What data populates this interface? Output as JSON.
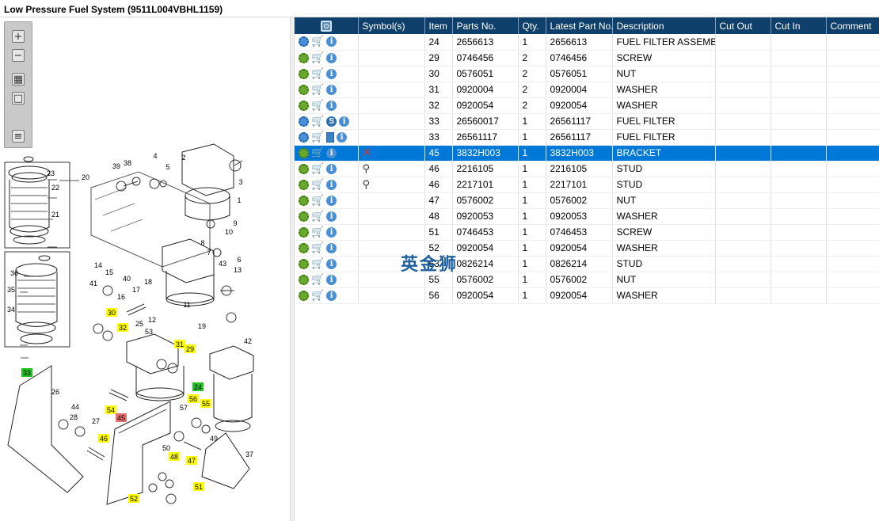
{
  "window": {
    "title": "Low Pressure Fuel System (9511L004VBHL1159)"
  },
  "toolbar": {
    "buttons": [
      {
        "name": "zoom-in-button",
        "glyph": "+"
      },
      {
        "name": "zoom-out-button",
        "glyph": "−"
      },
      {
        "name": "fit-all-button",
        "glyph": "▦"
      },
      {
        "name": "fit-page-button",
        "glyph": "□"
      },
      {
        "name": "show-list-button",
        "glyph": "≡"
      }
    ]
  },
  "diagram": {
    "callouts": [
      {
        "label": "23",
        "color": "none"
      },
      {
        "label": "22",
        "color": "none"
      },
      {
        "label": "21",
        "color": "none"
      },
      {
        "label": "20",
        "color": "none"
      },
      {
        "label": "36",
        "color": "none"
      },
      {
        "label": "35",
        "color": "none"
      },
      {
        "label": "34",
        "color": "none"
      },
      {
        "label": "33",
        "color": "green"
      },
      {
        "label": "39",
        "color": "none"
      },
      {
        "label": "38",
        "color": "none"
      },
      {
        "label": "4",
        "color": "none"
      },
      {
        "label": "5",
        "color": "none"
      },
      {
        "label": "2",
        "color": "none"
      },
      {
        "label": "3",
        "color": "none"
      },
      {
        "label": "1",
        "color": "none"
      },
      {
        "label": "10",
        "color": "none"
      },
      {
        "label": "9",
        "color": "none"
      },
      {
        "label": "8",
        "color": "none"
      },
      {
        "label": "7",
        "color": "none"
      },
      {
        "label": "6",
        "color": "none"
      },
      {
        "label": "14",
        "color": "none"
      },
      {
        "label": "15",
        "color": "none"
      },
      {
        "label": "18",
        "color": "none"
      },
      {
        "label": "43",
        "color": "none"
      },
      {
        "label": "13",
        "color": "none"
      },
      {
        "label": "41",
        "color": "none"
      },
      {
        "label": "40",
        "color": "none"
      },
      {
        "label": "16",
        "color": "none"
      },
      {
        "label": "17",
        "color": "none"
      },
      {
        "label": "12",
        "color": "none"
      },
      {
        "label": "11",
        "color": "none"
      },
      {
        "label": "19",
        "color": "none"
      },
      {
        "label": "30",
        "color": "yellow"
      },
      {
        "label": "32",
        "color": "yellow"
      },
      {
        "label": "25",
        "color": "none"
      },
      {
        "label": "53",
        "color": "none"
      },
      {
        "label": "31",
        "color": "yellow"
      },
      {
        "label": "29",
        "color": "yellow"
      },
      {
        "label": "42",
        "color": "none"
      },
      {
        "label": "24",
        "color": "green"
      },
      {
        "label": "26",
        "color": "none"
      },
      {
        "label": "44",
        "color": "none"
      },
      {
        "label": "28",
        "color": "none"
      },
      {
        "label": "27",
        "color": "none"
      },
      {
        "label": "54",
        "color": "yellow"
      },
      {
        "label": "45",
        "color": "red"
      },
      {
        "label": "57",
        "color": "none"
      },
      {
        "label": "56",
        "color": "yellow"
      },
      {
        "label": "55",
        "color": "yellow"
      },
      {
        "label": "46",
        "color": "yellow"
      },
      {
        "label": "50",
        "color": "none"
      },
      {
        "label": "49",
        "color": "none"
      },
      {
        "label": "48",
        "color": "yellow"
      },
      {
        "label": "47",
        "color": "yellow"
      },
      {
        "label": "37",
        "color": "none"
      },
      {
        "label": "52",
        "color": "yellow"
      },
      {
        "label": "51",
        "color": "yellow"
      }
    ]
  },
  "table": {
    "columns": [
      "Symbol(s)",
      "Item",
      "Parts No.",
      "Qty.",
      "Latest Part No.",
      "Description",
      "Cut Out",
      "Cut In",
      "Comment"
    ],
    "rows": [
      {
        "icons": "gear-blue,cart,info",
        "symbol": "",
        "item": "24",
        "part_no": "2656613",
        "qty": "1",
        "latest": "2656613",
        "desc": "FUEL FILTER ASSEMBLY",
        "cut_out": "",
        "cut_in": "",
        "comment": ""
      },
      {
        "icons": "gear,cart,info",
        "symbol": "",
        "item": "29",
        "part_no": "0746456",
        "qty": "2",
        "latest": "0746456",
        "desc": "SCREW",
        "cut_out": "",
        "cut_in": "",
        "comment": ""
      },
      {
        "icons": "gear,cart,info",
        "symbol": "",
        "item": "30",
        "part_no": "0576051",
        "qty": "2",
        "latest": "0576051",
        "desc": "NUT",
        "cut_out": "",
        "cut_in": "",
        "comment": ""
      },
      {
        "icons": "gear,cart,info",
        "symbol": "",
        "item": "31",
        "part_no": "0920004",
        "qty": "2",
        "latest": "0920004",
        "desc": "WASHER",
        "cut_out": "",
        "cut_in": "",
        "comment": ""
      },
      {
        "icons": "gear,cart,info",
        "symbol": "",
        "item": "32",
        "part_no": "0920054",
        "qty": "2",
        "latest": "0920054",
        "desc": "WASHER",
        "cut_out": "",
        "cut_in": "",
        "comment": ""
      },
      {
        "icons": "gear-blue,cart,s,info",
        "symbol": "",
        "item": "33",
        "part_no": "26560017",
        "qty": "1",
        "latest": "26561117",
        "desc": "FUEL FILTER",
        "cut_out": "",
        "cut_in": "",
        "comment": ""
      },
      {
        "icons": "gear-blue,cart,doc,info",
        "symbol": "",
        "item": "33",
        "part_no": "26561117",
        "qty": "1",
        "latest": "26561117",
        "desc": "FUEL FILTER",
        "cut_out": "",
        "cut_in": "",
        "comment": ""
      },
      {
        "icons": "gear,cart,info",
        "symbol": "x",
        "item": "45",
        "part_no": "3832H003",
        "qty": "1",
        "latest": "3832H003",
        "desc": "BRACKET",
        "cut_out": "",
        "cut_in": "",
        "comment": "",
        "selected": true
      },
      {
        "icons": "gear,cart,info",
        "symbol": "pin",
        "item": "46",
        "part_no": "2216105",
        "qty": "1",
        "latest": "2216105",
        "desc": "STUD",
        "cut_out": "",
        "cut_in": "",
        "comment": ""
      },
      {
        "icons": "gear,cart,info",
        "symbol": "pin",
        "item": "46",
        "part_no": "2217101",
        "qty": "1",
        "latest": "2217101",
        "desc": "STUD",
        "cut_out": "",
        "cut_in": "",
        "comment": ""
      },
      {
        "icons": "gear,cart,info",
        "symbol": "",
        "item": "47",
        "part_no": "0576002",
        "qty": "1",
        "latest": "0576002",
        "desc": "NUT",
        "cut_out": "",
        "cut_in": "",
        "comment": ""
      },
      {
        "icons": "gear,cart,info",
        "symbol": "",
        "item": "48",
        "part_no": "0920053",
        "qty": "1",
        "latest": "0920053",
        "desc": "WASHER",
        "cut_out": "",
        "cut_in": "",
        "comment": ""
      },
      {
        "icons": "gear,cart,info",
        "symbol": "",
        "item": "51",
        "part_no": "0746453",
        "qty": "1",
        "latest": "0746453",
        "desc": "SCREW",
        "cut_out": "",
        "cut_in": "",
        "comment": ""
      },
      {
        "icons": "gear,cart,info",
        "symbol": "",
        "item": "52",
        "part_no": "0920054",
        "qty": "1",
        "latest": "0920054",
        "desc": "WASHER",
        "cut_out": "",
        "cut_in": "",
        "comment": ""
      },
      {
        "icons": "gear,cart,info",
        "symbol": "",
        "item": "53",
        "part_no": "0826214",
        "qty": "1",
        "latest": "0826214",
        "desc": "STUD",
        "cut_out": "",
        "cut_in": "",
        "comment": ""
      },
      {
        "icons": "gear,cart,info",
        "symbol": "",
        "item": "55",
        "part_no": "0576002",
        "qty": "1",
        "latest": "0576002",
        "desc": "NUT",
        "cut_out": "",
        "cut_in": "",
        "comment": ""
      },
      {
        "icons": "gear,cart,info",
        "symbol": "",
        "item": "56",
        "part_no": "0920054",
        "qty": "1",
        "latest": "0920054",
        "desc": "WASHER",
        "cut_out": "",
        "cut_in": "",
        "comment": ""
      }
    ]
  },
  "watermark": {
    "text": "英金狮"
  },
  "colors": {
    "header_bg": "#0f3f6b",
    "selected_row": "#0078d7",
    "callout_yellow": "#ffff00",
    "callout_green": "#22c322",
    "callout_red": "#e87070"
  }
}
